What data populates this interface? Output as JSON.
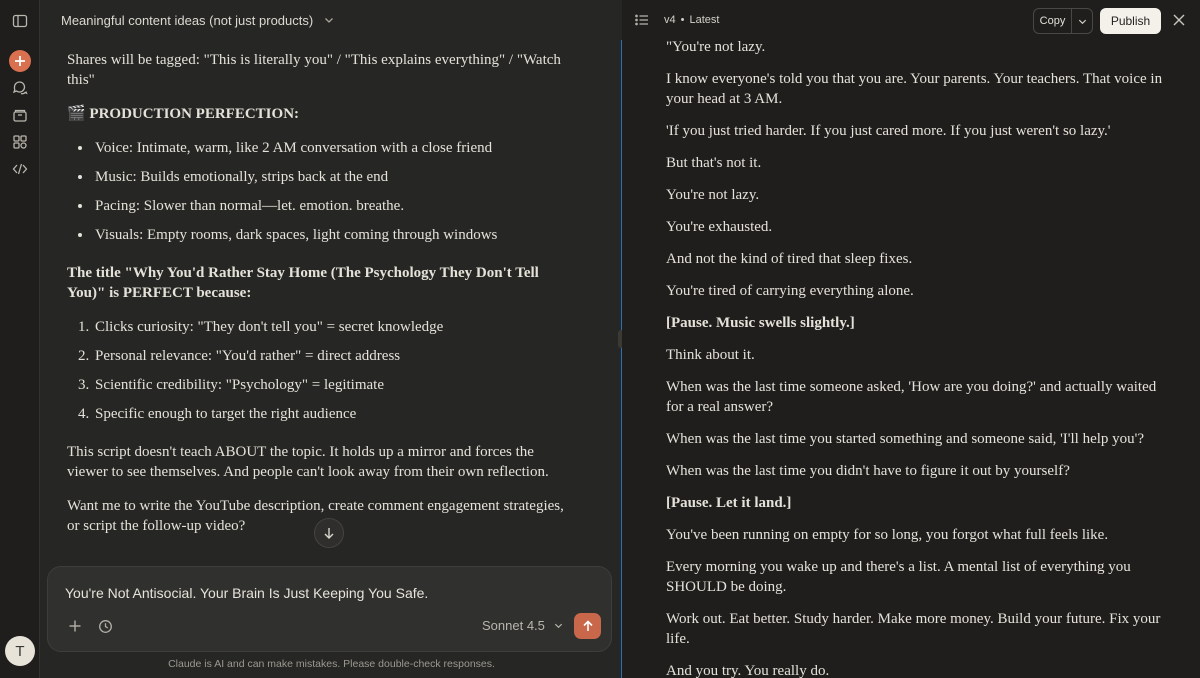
{
  "rail": {
    "avatar_letter": "T"
  },
  "chat": {
    "title": "Meaningful content ideas (not just products)",
    "intro": "Shares will be tagged: \"This is literally you\" / \"This explains everything\" / \"Watch this\"",
    "production_heading": "🎬 PRODUCTION PERFECTION:",
    "production_items": [
      "Voice: Intimate, warm, like 2 AM conversation with a close friend",
      "Music: Builds emotionally, strips back at the end",
      "Pacing: Slower than normal—let. emotion. breathe.",
      "Visuals: Empty rooms, dark spaces, light coming through windows"
    ],
    "title_heading": "The title \"Why You'd Rather Stay Home (The Psychology They Don't Tell You)\" is PERFECT because:",
    "title_reasons": [
      "Clicks curiosity: \"They don't tell you\" = secret knowledge",
      "Personal relevance: \"You'd rather\" = direct address",
      "Scientific credibility: \"Psychology\" = legitimate",
      "Specific enough to target the right audience"
    ],
    "summary": "This script doesn't teach ABOUT the topic. It holds up a mirror and forces the viewer to see themselves. And people can't look away from their own reflection.",
    "followup": "Want me to write the YouTube description, create comment engagement strategies, or script the follow-up video?",
    "composer_text": "You're Not Antisocial. Your Brain Is Just Keeping You Safe.",
    "model": "Sonnet 4.5",
    "disclaimer": "Claude is AI and can make mistakes. Please double-check responses."
  },
  "artifact": {
    "version": "v4",
    "version_status": "Latest",
    "copy_label": "Copy",
    "publish_label": "Publish",
    "lines": [
      {
        "text": "\"You're not lazy.",
        "bold": false
      },
      {
        "text": "I know everyone's told you that you are. Your parents. Your teachers. That voice in your head at 3 AM.",
        "bold": false
      },
      {
        "text": "'If you just tried harder. If you just cared more. If you just weren't so lazy.'",
        "bold": false
      },
      {
        "text": "But that's not it.",
        "bold": false
      },
      {
        "text": "You're not lazy.",
        "bold": false
      },
      {
        "text": "You're exhausted.",
        "bold": false
      },
      {
        "text": "And not the kind of tired that sleep fixes.",
        "bold": false
      },
      {
        "text": "You're tired of carrying everything alone.",
        "bold": false
      },
      {
        "text": "[Pause. Music swells slightly.]",
        "bold": true
      },
      {
        "text": "Think about it.",
        "bold": false
      },
      {
        "text": "When was the last time someone asked, 'How are you doing?' and actually waited for a real answer?",
        "bold": false
      },
      {
        "text": "When was the last time you started something and someone said, 'I'll help you'?",
        "bold": false
      },
      {
        "text": "When was the last time you didn't have to figure it out by yourself?",
        "bold": false
      },
      {
        "text": "[Pause. Let it land.]",
        "bold": true
      },
      {
        "text": "You've been running on empty for so long, you forgot what full feels like.",
        "bold": false
      },
      {
        "text": "Every morning you wake up and there's a list. A mental list of everything you SHOULD be doing.",
        "bold": false
      },
      {
        "text": "Work out. Eat better. Study harder. Make more money. Build your future. Fix your life.",
        "bold": false
      },
      {
        "text": "And you try. You really do.",
        "bold": false
      }
    ]
  }
}
